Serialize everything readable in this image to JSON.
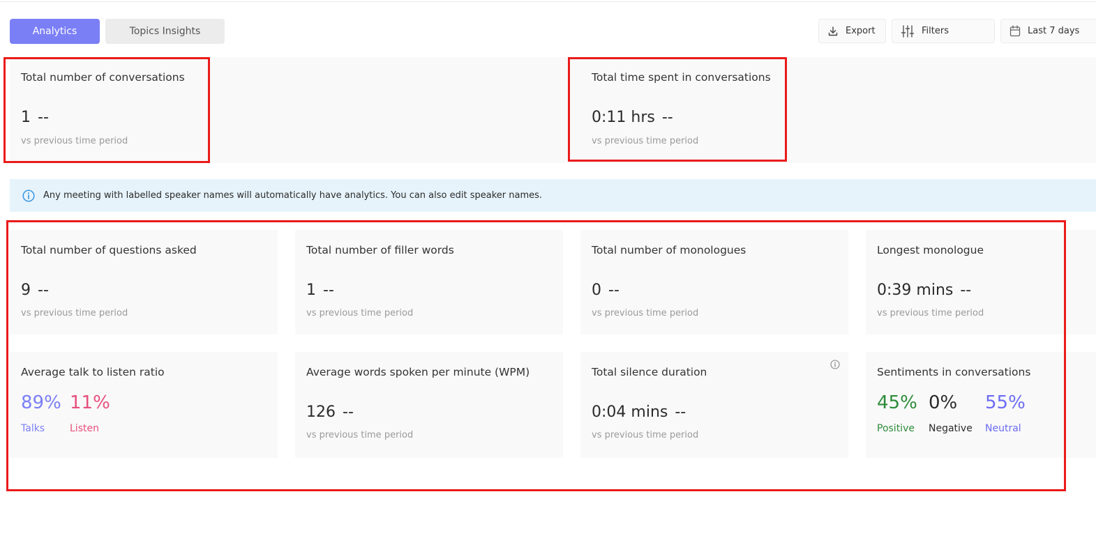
{
  "tabs": [
    {
      "label": "Analytics",
      "active": true
    },
    {
      "label": "Topics Insights",
      "active": false
    }
  ],
  "toolbar": {
    "export_label": "Export",
    "filters_label": "Filters",
    "date_label": "Last 7 days"
  },
  "summary": {
    "conversations": {
      "title": "Total number of conversations",
      "value": "1",
      "change": "--",
      "sub": "vs previous time period"
    },
    "time_spent": {
      "title": "Total time spent in conversations",
      "value": "0:11 hrs",
      "change": "--",
      "sub": "vs previous time period"
    }
  },
  "banner": {
    "text": "Any meeting with labelled speaker names will automatically have analytics. You can also edit speaker names.",
    "icon": "info-icon"
  },
  "metrics": {
    "questions": {
      "title": "Total number of questions asked",
      "value": "9",
      "change": "--",
      "sub": "vs previous time period"
    },
    "filler": {
      "title": "Total number of filler words",
      "value": "1",
      "change": "--",
      "sub": "vs previous time period"
    },
    "monologues": {
      "title": "Total number of monologues",
      "value": "0",
      "change": "--",
      "sub": "vs previous time period"
    },
    "longest": {
      "title": "Longest monologue",
      "value": "0:39 mins",
      "change": "--",
      "sub": "vs previous time period"
    },
    "talk_listen": {
      "title": "Average talk to listen ratio",
      "talk_value": "89%",
      "talk_label": "Talks",
      "listen_value": "11%",
      "listen_label": "Listen"
    },
    "wpm": {
      "title": "Average words spoken per minute (WPM)",
      "value": "126",
      "change": "--",
      "sub": "vs previous time period"
    },
    "silence": {
      "title": "Total silence duration",
      "value": "0:04 mins",
      "change": "--",
      "sub": "vs previous time period"
    },
    "sentiments": {
      "title": "Sentiments in conversations",
      "positive_value": "45%",
      "positive_label": "Positive",
      "negative_value": "0%",
      "negative_label": "Negative",
      "neutral_value": "55%",
      "neutral_label": "Neutral"
    }
  },
  "colors": {
    "accent": "#7b7ff6",
    "talk": "#7b7ff6",
    "listen": "#e8507d",
    "positive": "#2e8b3a",
    "negative": "#2b2b2b",
    "neutral": "#6c6cf5",
    "highlight": "#ea1b1b"
  }
}
